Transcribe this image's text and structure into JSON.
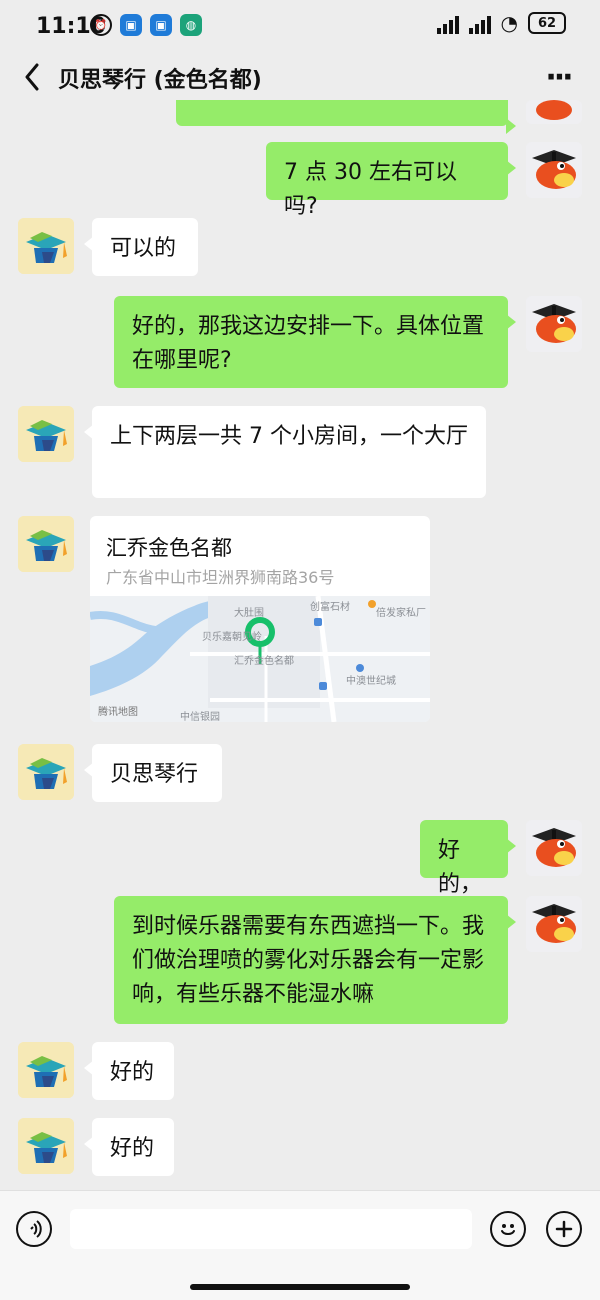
{
  "status_bar": {
    "time": "11:10",
    "battery": "62"
  },
  "header": {
    "title": "贝思琴行 (金色名都)"
  },
  "messages": [
    {
      "side": "sent",
      "text": "7 点 30 左右可以吗?"
    },
    {
      "side": "recv",
      "text": "可以的"
    },
    {
      "side": "sent",
      "text": "好的，那我这边安排一下。具体位置在哪里呢?"
    },
    {
      "side": "recv",
      "text": "上下两层一共 7 个小房间，一个大厅"
    },
    {
      "side": "recv_location",
      "name": "汇乔金色名都",
      "address": "广东省中山市坦洲界狮南路36号"
    },
    {
      "side": "recv",
      "text": "贝思琴行"
    },
    {
      "side": "sent",
      "text": "好的，"
    },
    {
      "side": "sent",
      "text": "到时候乐器需要有东西遮挡一下。我们做治理喷的雾化对乐器会有一定影响，有些乐器不能湿水嘛"
    },
    {
      "side": "recv",
      "text": "好的"
    },
    {
      "side": "recv",
      "text": "好的"
    }
  ],
  "map": {
    "labels": [
      "大肚围",
      "创富石材",
      "倍发家私厂",
      "贝乐嘉朝见岭",
      "汇乔金色名都",
      "中澳世纪城",
      "中信银园",
      "腾讯地图"
    ]
  },
  "input": {
    "placeholder": ""
  }
}
